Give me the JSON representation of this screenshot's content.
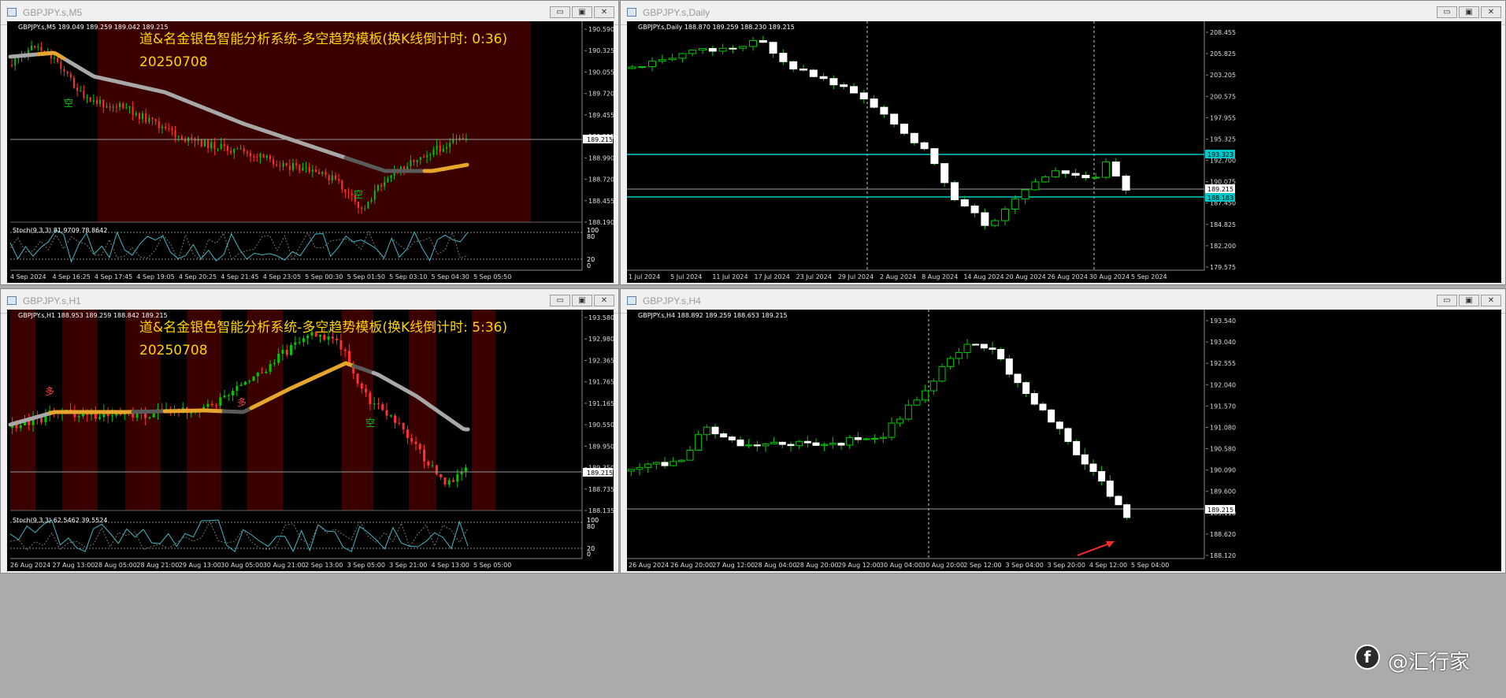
{
  "windows": {
    "m5": {
      "title": "GBPJPY.s,M5",
      "info": "GBPJPY.s,M5  189.049 189.259 189.042 189.215",
      "overlay_title": "道&名金银色智能分析系统-多空趋势模板(换K线倒计时: 0:36)",
      "overlay_date": "20250708",
      "prices": [
        "190.590",
        "190.325",
        "190.055",
        "189.720",
        "189.455",
        "189.215",
        "188.990",
        "188.720",
        "188.455",
        "188.190"
      ],
      "current_price": "189.215",
      "stoch_label": "Stoch(9,3,3) 81.9709 78.8642",
      "stoch_levels": [
        "100",
        "80",
        "20",
        "0"
      ],
      "times": [
        "4 Sep 2024",
        "4 Sep 16:25",
        "4 Sep 17:45",
        "4 Sep 19:05",
        "4 Sep 20:25",
        "4 Sep 21:45",
        "4 Sep 23:05",
        "5 Sep 00:30",
        "5 Sep 01:50",
        "5 Sep 03:10",
        "5 Sep 04:30",
        "5 Sep 05:50"
      ],
      "marker_sell": "空"
    },
    "daily": {
      "title": "GBPJPY.s,Daily",
      "info": "GBPJPY.s,Daily  188.870 189.259 188.230 189.215",
      "prices": [
        "208.455",
        "205.825",
        "203.205",
        "200.575",
        "197.955",
        "195.325",
        "192.700",
        "190.075",
        "187.450",
        "184.825",
        "182.200",
        "179.575"
      ],
      "current_price": "189.215",
      "level_high": "193.323",
      "level_low": "188.183",
      "times": [
        "1 Jul 2024",
        "5 Jul 2024",
        "11 Jul 2024",
        "17 Jul 2024",
        "23 Jul 2024",
        "29 Jul 2024",
        "2 Aug 2024",
        "8 Aug 2024",
        "14 Aug 2024",
        "20 Aug 2024",
        "26 Aug 2024",
        "30 Aug 2024",
        "5 Sep 2024"
      ]
    },
    "h1": {
      "title": "GBPJPY.s,H1",
      "info": "GBPJPY.s,H1  188.953 189.259 188.842 189.215",
      "overlay_title": "道&名金银色智能分析系统-多空趋势模板(换K线倒计时: 5:36)",
      "overlay_date": "20250708",
      "prices": [
        "193.580",
        "192.980",
        "192.365",
        "191.765",
        "191.165",
        "190.550",
        "189.950",
        "189.350",
        "188.735",
        "188.135"
      ],
      "current_price": "189.215",
      "stoch_label": "Stoch(9,3,3) 62.5462 39.5524",
      "stoch_levels": [
        "100",
        "80",
        "20",
        "0"
      ],
      "times": [
        "26 Aug 2024",
        "27 Aug 13:00",
        "28 Aug 05:00",
        "28 Aug 21:00",
        "29 Aug 13:00",
        "30 Aug 05:00",
        "30 Aug 21:00",
        "2 Sep 13:00",
        "3 Sep 05:00",
        "3 Sep 21:00",
        "4 Sep 13:00",
        "5 Sep 05:00"
      ],
      "marker_buy": "多",
      "marker_sell": "空"
    },
    "h4": {
      "title": "GBPJPY.s,H4",
      "info": "GBPJPY.s,H4  188.892 189.259 188.653 189.215",
      "prices": [
        "193.540",
        "193.040",
        "192.555",
        "192.040",
        "191.570",
        "191.080",
        "190.580",
        "190.090",
        "189.600",
        "189.110",
        "188.620",
        "188.120"
      ],
      "current_price": "189.215",
      "times": [
        "26 Aug 2024",
        "26 Aug 20:00",
        "27 Aug 12:00",
        "28 Aug 04:00",
        "28 Aug 20:00",
        "29 Aug 12:00",
        "30 Aug 04:00",
        "30 Aug 20:00",
        "2 Sep 12:00",
        "3 Sep 04:00",
        "3 Sep 20:00",
        "4 Sep 12:00",
        "5 Sep 04:00"
      ]
    }
  },
  "buttons": {
    "minimize": "▭",
    "restore": "▣",
    "close": "✕"
  },
  "watermark": {
    "logo": "f",
    "text": "@汇行家"
  },
  "colors": {
    "red_session": "#3a0000",
    "ma_bear": "#a8a8a8",
    "ma_bull": "#e6a52c",
    "candle_up": "#00c800",
    "candle_down": "#ff3030",
    "level_line": "#00c8c8",
    "overlay_text": "#ffd200"
  }
}
